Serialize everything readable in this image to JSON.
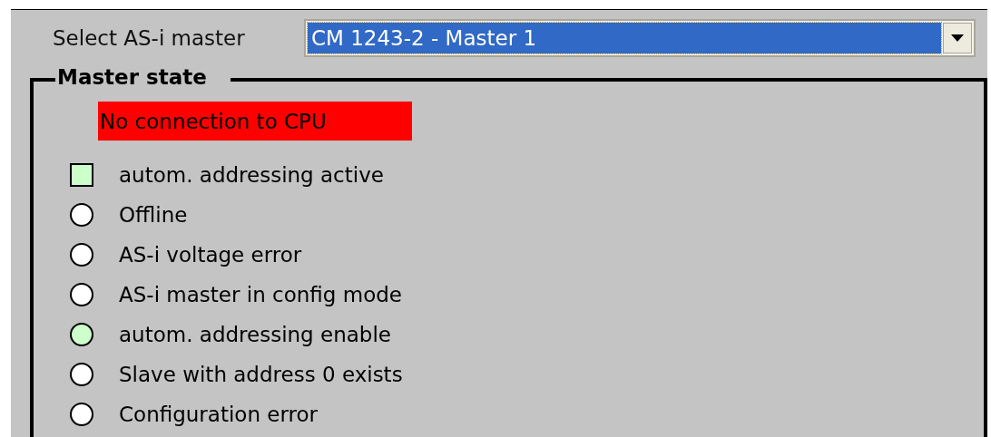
{
  "master_select": {
    "label": "Select AS-i master",
    "value": "CM 1243-2 - Master 1"
  },
  "master_state": {
    "title": "Master state",
    "alarm": "No connection to CPU",
    "indicators": [
      {
        "kind": "square",
        "label": "autom. addressing active",
        "on": true
      },
      {
        "kind": "circle",
        "label": "Offline",
        "on": false
      },
      {
        "kind": "circle",
        "label": "AS-i voltage error",
        "on": false
      },
      {
        "kind": "circle",
        "label": "AS-i master in config mode",
        "on": false
      },
      {
        "kind": "circle",
        "label": "autom. addressing enable",
        "on": true
      },
      {
        "kind": "circle",
        "label": "Slave with address 0 exists",
        "on": false
      },
      {
        "kind": "circle",
        "label": "Configuration error",
        "on": false
      }
    ]
  }
}
